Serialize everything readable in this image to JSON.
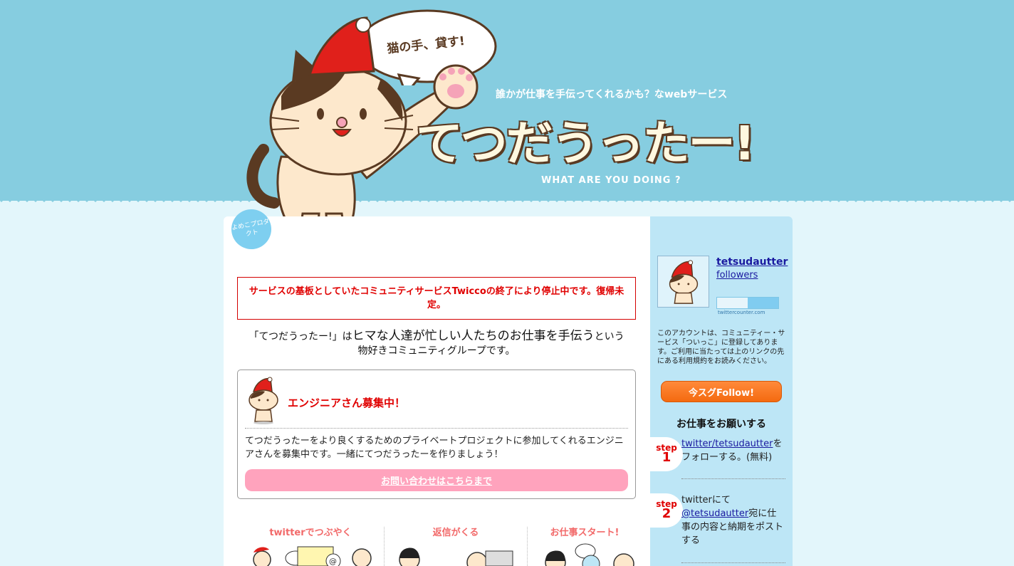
{
  "header": {
    "speech_bubble": "猫の手、貸す!",
    "tagline": "誰かが仕事を手伝ってくれるかも？なwebサービス",
    "logo": "てつだうったー!",
    "subtitle": "WHAT ARE YOU DOING ?",
    "badge": "よめこプロダクト"
  },
  "notice": "サービスの基板としていたコミュニティサービスTwiccoの終了により停止中です。復帰未定。",
  "intro": {
    "part1": "「てつだうったー!」は",
    "part2": "ヒマな人達が忙しい人たちのお仕事を手伝う",
    "part3": "という",
    "line2": "物好きコミュニティグループです。"
  },
  "recruit": {
    "title": "エンジニアさん募集中！",
    "body": "てつだうったーをより良くするためのプライベートプロジェクトに参加してくれるエンジニアさんを募集中です。一緒にてつだうったーを作りましょう！",
    "button": "お問い合わせはこちらまで"
  },
  "flow": [
    {
      "label": "twitterでつぶやく"
    },
    {
      "label": "返信がくる"
    },
    {
      "label": "お仕事スタート!"
    }
  ],
  "sidebar": {
    "account_name": "tetsudautter",
    "followers_label": "followers",
    "counter_label": "twittercounter.com",
    "note": "このアカウントは、コミュニティー・サービス「ついっこ」に登録してあります。ご利用に当たっては上のリンクの先にある利用規約をお読みください。",
    "follow_button": "今スグFollow!",
    "heading": "お仕事をお願いする",
    "steps": [
      {
        "word": "step",
        "num": "1",
        "link": "twitter/tetsudautter",
        "text": "をフォローする。(無料)"
      },
      {
        "word": "step",
        "num": "2",
        "prefix": "twitterにて",
        "link": "@tetsudautter",
        "text": "宛に仕事の内容と納期をポストする"
      }
    ]
  }
}
